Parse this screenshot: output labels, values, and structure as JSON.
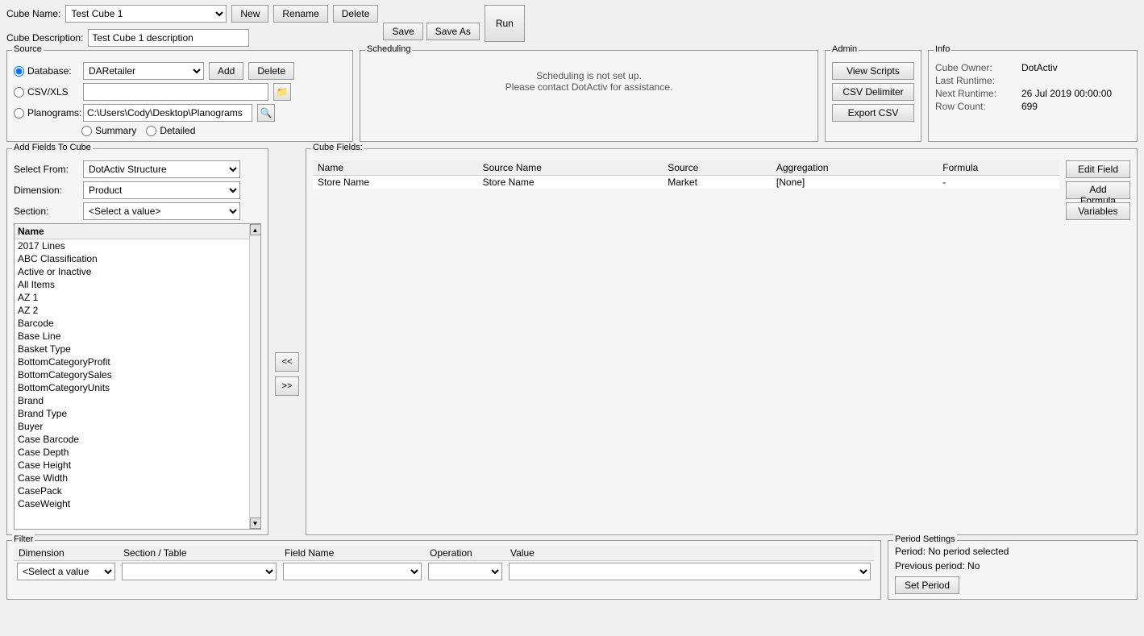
{
  "header": {
    "cube_name_label": "Cube Name:",
    "cube_name_value": "Test Cube 1",
    "cube_desc_label": "Cube Description:",
    "cube_desc_value": "Test Cube 1 description",
    "btn_new": "New",
    "btn_rename": "Rename",
    "btn_delete": "Delete",
    "btn_save": "Save",
    "btn_save_as": "Save As",
    "btn_run": "Run"
  },
  "source": {
    "title": "Source",
    "db_label": "Database:",
    "db_value": "DARetailer",
    "btn_add": "Add",
    "btn_delete": "Delete",
    "csv_label": "CSV/XLS",
    "planograms_label": "Planograms:",
    "planograms_path": "C:\\Users\\Cody\\Desktop\\Planograms",
    "summary_label": "Summary",
    "detailed_label": "Detailed"
  },
  "scheduling": {
    "title": "Scheduling",
    "message_line1": "Scheduling is not set up.",
    "message_line2": "Please contact DotActiv for assistance."
  },
  "admin": {
    "title": "Admin",
    "btn_view_scripts": "View Scripts",
    "btn_csv_delimiter": "CSV Delimiter",
    "btn_export_csv": "Export CSV"
  },
  "info": {
    "title": "Info",
    "cube_owner_label": "Cube Owner:",
    "cube_owner_value": "DotActiv",
    "last_runtime_label": "Last Runtime:",
    "last_runtime_value": "",
    "next_runtime_label": "Next Runtime:",
    "next_runtime_value": "26 Jul 2019 00:00:00",
    "row_count_label": "Row Count:",
    "row_count_value": "699"
  },
  "add_fields": {
    "title": "Add Fields To Cube",
    "select_from_label": "Select From:",
    "select_from_value": "DotActiv Structure",
    "dimension_label": "Dimension:",
    "dimension_value": "Product",
    "section_label": "Section:",
    "section_value": "<Select a value>",
    "name_header": "Name",
    "items": [
      "2017 Lines",
      "ABC Classification",
      "Active or Inactive",
      "All Items",
      "AZ 1",
      "AZ 2",
      "Barcode",
      "Base Line",
      "Basket Type",
      "BottomCategoryProfit",
      "BottomCategorySales",
      "BottomCategoryUnits",
      "Brand",
      "Brand Type",
      "Buyer",
      "Case Barcode",
      "Case Depth",
      "Case Height",
      "Case Width",
      "CasePack",
      "CaseWeight"
    ],
    "btn_transfer_left": "<<",
    "btn_transfer_right": ">>"
  },
  "cube_fields": {
    "title": "Cube Fields:",
    "columns": [
      "Name",
      "Source Name",
      "Source",
      "Aggregation",
      "Formula"
    ],
    "rows": [
      {
        "name": "Store Name",
        "source_name": "Store Name",
        "source": "Market",
        "aggregation": "[None]",
        "formula": "-"
      }
    ],
    "btn_edit_field": "Edit Field",
    "btn_add_formula": "Add Formula",
    "btn_variables": "Variables"
  },
  "filter": {
    "title": "Filter",
    "columns": [
      "Dimension",
      "Section / Table",
      "Field Name",
      "Operation",
      "Value"
    ],
    "select_value_placeholder": "<Select a value"
  },
  "period_settings": {
    "title": "Period Settings",
    "period_label": "Period: No period selected",
    "previous_period_label": "Previous period: No",
    "btn_set_period": "Set Period"
  }
}
